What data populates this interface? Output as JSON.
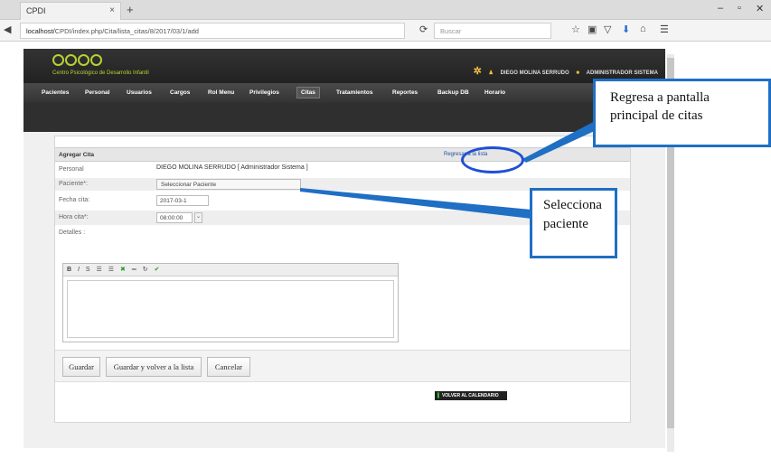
{
  "browser": {
    "tab_title": "CPDI",
    "tab_close": "×",
    "new_tab": "+",
    "url_prefix": "localhost/",
    "url_path": "CPDI/index.php/Cita/lista_citas/8/2017/03/1/add",
    "search_placeholder": "Buscar",
    "reload_icon": "⟳",
    "search_icon": "🔍"
  },
  "app": {
    "logo_text": "Centro Psicológico de Desarrollo Infantil",
    "user_name": "DIEGO MOLINA SERRUDO",
    "user_role": "ADMINISTRADOR SISTEMA",
    "menu": [
      "Pacientes",
      "Personal",
      "Usuarios",
      "Cargos",
      "Rol Menu",
      "Privilegios",
      "Citas",
      "Tratamientos",
      "Reportes",
      "Backup DB",
      "Horario"
    ],
    "menu_active": "Citas"
  },
  "form": {
    "title": "Agregar Cita",
    "back_link": "Regresar a la lista",
    "fields": [
      {
        "label": "Personal",
        "value": "DIEGO MOLINA SERRUDO [ Administrador Sistema ]"
      },
      {
        "label": "Paciente*:",
        "value": "Seleccionar Paciente"
      },
      {
        "label": "Fecha cita:",
        "value": "2017-03-1"
      },
      {
        "label": "Hora cita*:",
        "value": "08:00:00"
      },
      {
        "label": "Detalles :",
        "value": ""
      }
    ],
    "editor_tools": [
      "B",
      "I",
      "S",
      "☰",
      "☰",
      "✖",
      "═",
      "↻",
      "✔"
    ],
    "buttons": {
      "save": "Guardar",
      "save_return": "Guardar y volver a la lista",
      "cancel": "Cancelar"
    },
    "calendar_button": "VOLVER AL CALENDARIO"
  },
  "annotations": {
    "callout_back": "Regresa a pantalla principal de citas",
    "callout_patient": "Selecciona paciente",
    "accent": "#1f6fc4"
  }
}
